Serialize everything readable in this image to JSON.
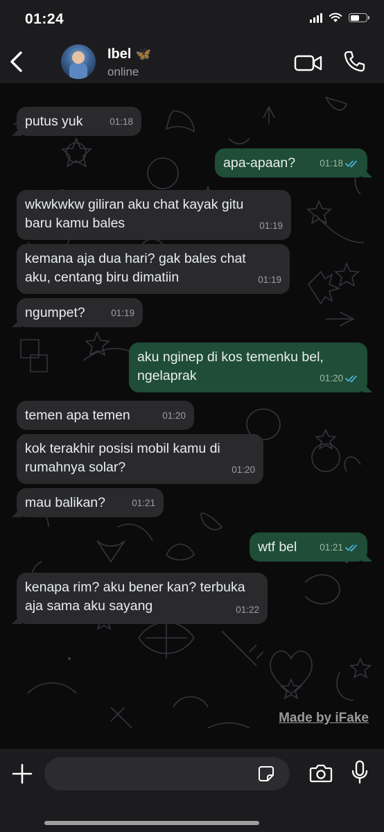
{
  "status_bar": {
    "time": "01:24"
  },
  "header": {
    "contact_name": "Ibel",
    "contact_emoji": "🦋",
    "contact_status": "online"
  },
  "messages": [
    {
      "dir": "in",
      "text": "putus yuk",
      "time": "01:18"
    },
    {
      "dir": "out",
      "text": "apa-apaan?",
      "time": "01:18",
      "read": true
    },
    {
      "dir": "in",
      "text": "wkwkwkw giliran aku chat kayak gitu\nbaru kamu bales",
      "time": "01:19"
    },
    {
      "dir": "in",
      "text": "kemana aja dua hari? gak bales chat\naku, centang biru dimatiin",
      "time": "01:19"
    },
    {
      "dir": "in",
      "text": "ngumpet?",
      "time": "01:19"
    },
    {
      "dir": "out",
      "text": "aku nginep di kos temenku bel,\nngelaprak",
      "time": "01:20",
      "read": true
    },
    {
      "dir": "in",
      "text": "temen apa temen",
      "time": "01:20"
    },
    {
      "dir": "in",
      "text": "kok terakhir posisi mobil kamu di\nrumahnya solar?",
      "time": "01:20"
    },
    {
      "dir": "in",
      "text": "mau balikan?",
      "time": "01:21"
    },
    {
      "dir": "out",
      "text": "wtf bel",
      "time": "01:21",
      "read": true
    },
    {
      "dir": "in",
      "text": "kenapa rim? aku bener kan? terbuka\naja sama aku sayang",
      "time": "01:22"
    }
  ],
  "watermark": "Made by iFake",
  "input": {
    "value": "",
    "placeholder": ""
  },
  "colors": {
    "incoming_bubble": "#2a2a2c",
    "outgoing_bubble": "#1f4d37",
    "read_ticks": "#53bdeb",
    "header_bg": "#1c1c1e"
  },
  "icons": {
    "back": "chevron-left-icon",
    "video": "video-camera-icon",
    "call": "phone-icon",
    "add": "plus-icon",
    "sticker": "sticker-icon",
    "camera": "camera-icon",
    "mic": "microphone-icon"
  }
}
